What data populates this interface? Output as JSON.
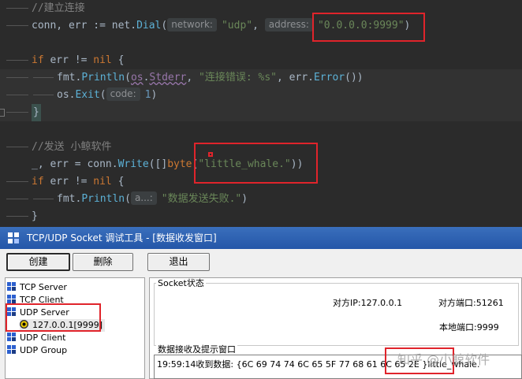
{
  "editor": {
    "line1": "//建立连接",
    "line2": {
      "a": "conn, err := net.",
      "fn": "Dial",
      "paren": "(",
      "hint1": "network:",
      "s1": "\"udp\"",
      "comma": ", ",
      "hint2": "address:",
      "s2": "\"0.0.0.0:9999\"",
      "close": ")"
    },
    "line4": {
      "kw": "if",
      "rest": " err != ",
      "nil": "nil",
      "brace": " {"
    },
    "line5": {
      "a": "fmt.",
      "fn": "Println",
      "p": "(",
      "pkg": "os",
      "dot": ".",
      "pkg2": "Stderr",
      "sep": ", ",
      "str": "\"连接错误: %s\"",
      "rest": ", err.",
      "fn2": "Error",
      "end": "())"
    },
    "line6": {
      "a": "os.",
      "fn": "Exit",
      "p": "(",
      "hint": "code:",
      "num": "1",
      "end": ")"
    },
    "line7": "}",
    "line9": "//发送 小鲸软件",
    "line10": {
      "a": "_, err = conn.",
      "fn": "Write",
      "mid": "([]",
      "kw": "byte",
      "p": "(",
      "str": "\"little_whale.\"",
      "end": "))"
    },
    "line11": {
      "kw": "if",
      "rest": " err != ",
      "nil": "nil",
      "brace": " {"
    },
    "line12": {
      "a": "fmt.",
      "fn": "Println",
      "p": "(",
      "hint": "a...:",
      "str": "\"数据发送失败.\"",
      "end": ")"
    },
    "line13": "}"
  },
  "tool": {
    "title": "TCP/UDP Socket 调试工具 - [数据收发窗口]",
    "buttons": {
      "create": "创建",
      "delete": "删除",
      "exit": "退出"
    },
    "tree": {
      "tcp_server": "TCP Server",
      "tcp_client": "TCP Client",
      "udp_server": "UDP Server",
      "udp_server_child": "127.0.0.1[9999]",
      "udp_client": "UDP Client",
      "udp_group": "UDP Group"
    },
    "socket_status": {
      "label": "Socket状态",
      "peer_ip": "对方IP:127.0.0.1",
      "peer_port": "对方端口:51261",
      "local_port": "本地端口:9999"
    },
    "recv": {
      "label": "数据接收及提示窗口",
      "content": "19:59:14收到数据: {6C 69 74 74 6C 65 5F 77 68 61 6C 65 2E }little_whale."
    },
    "watermark": "知乎 @小鲸软件"
  },
  "colors": {
    "highlight_box": "#e0242b",
    "title_bar": "#2456a8",
    "editor_bg": "#2b2b2b"
  }
}
